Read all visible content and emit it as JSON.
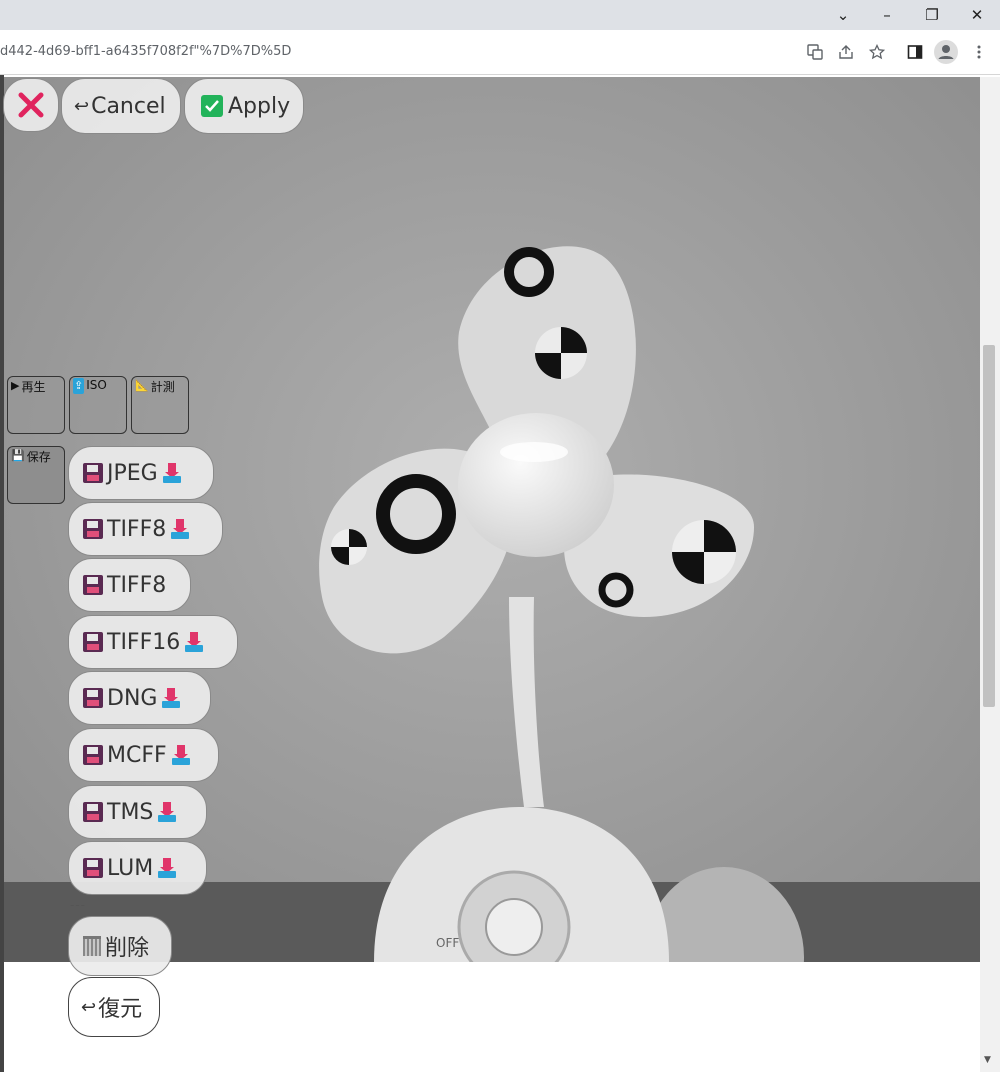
{
  "browser": {
    "url": "d442-4d69-bff1-a6435f708f2f\"%7D%7D%5D",
    "window_buttons": [
      "⌄",
      "–",
      "❐",
      "✕"
    ],
    "toolbar_icons": [
      "translate-icon",
      "share-icon",
      "star-icon",
      "side-panel-icon",
      "profile-icon",
      "menu-icon"
    ]
  },
  "top_buttons": {
    "close_glyph": "✕",
    "cancel_icon": "↩",
    "cancel_label": "Cancel",
    "apply_label": "Apply"
  },
  "mode_tiles": [
    {
      "icon": "▶",
      "label": "再生"
    },
    {
      "icon": "⇪",
      "label": "ISO"
    },
    {
      "icon": "📐",
      "label": "計測"
    },
    {
      "icon": "💾",
      "label": "保存"
    }
  ],
  "formats": [
    {
      "label": "JPEG",
      "download": true
    },
    {
      "label": "TIFF8",
      "download": true
    },
    {
      "label": "TIFF8",
      "download": false
    },
    {
      "label": "TIFF16",
      "download": true
    },
    {
      "label": "DNG",
      "download": true
    },
    {
      "label": "MCFF",
      "download": true
    },
    {
      "label": "TMS",
      "download": true
    },
    {
      "label": "LUM",
      "download": true
    }
  ],
  "separator": "---",
  "delete_label": "削除",
  "restore_icon": "↩",
  "restore_label": "復元",
  "colors": {
    "apply_green": "#22b35a",
    "close_red": "#e0245e",
    "floppy_purple": "#5a2a52"
  }
}
